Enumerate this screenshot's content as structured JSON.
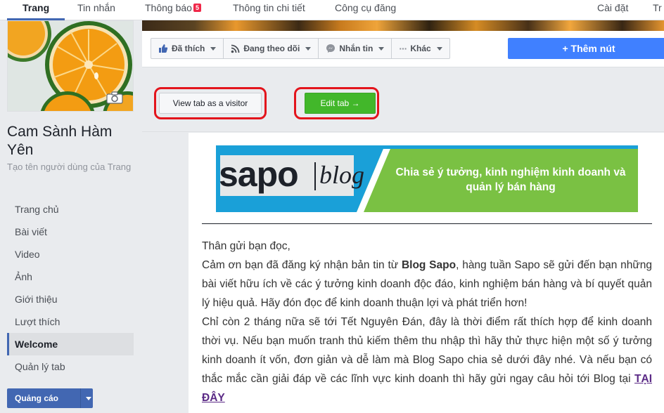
{
  "topnav": {
    "items": [
      "Trang",
      "Tin nhắn",
      "Thông báo",
      "Thông tin chi tiết",
      "Công cụ đăng",
      "Cài đặt",
      "Tr"
    ],
    "notification_count": "5"
  },
  "page": {
    "name": "Cam Sành Hàm Yên",
    "username_hint": "Tạo tên người dùng của Trang"
  },
  "sidebar": {
    "items": [
      {
        "label": "Trang chủ"
      },
      {
        "label": "Bài viết"
      },
      {
        "label": "Video"
      },
      {
        "label": "Ảnh"
      },
      {
        "label": "Giới thiệu"
      },
      {
        "label": "Lượt thích"
      },
      {
        "label": "Welcome"
      },
      {
        "label": "Quản lý tab"
      }
    ],
    "active_index": 6,
    "ads_label": "Quảng cáo"
  },
  "actions": {
    "liked": "Đã thích",
    "following": "Đang theo dõi",
    "message": "Nhắn tin",
    "more": "Khác",
    "add_button": "+ Thêm nút"
  },
  "tab_controls": {
    "view_as_visitor": "View tab as a visitor",
    "edit_tab": "Edit tab →"
  },
  "banner": {
    "brand": "sapo",
    "blog": "blog",
    "tagline": "Chia sẻ ý tưởng, kinh nghiệm kinh doanh và quản lý bán hàng"
  },
  "article": {
    "greeting": "Thân gửi bạn đọc,",
    "p1_a": "Cảm ơn bạn đã đăng ký nhận bản tin từ ",
    "p1_bold": "Blog Sapo",
    "p1_b": ", hàng tuần Sapo sẽ gửi đến bạn những bài viết hữu ích về các ý tưởng kinh doanh độc đáo, kinh nghiệm bán hàng và bí quyết quản lý hiệu quả. Hãy đón đọc để kinh doanh thuận lợi và phát triển hơn!",
    "p2": "Chỉ còn 2 tháng nữa sẽ tới Tết Nguyên Đán, đây là thời điểm rất thích hợp để kinh doanh thời vụ. Nếu bạn muốn tranh thủ kiếm thêm thu nhập thì hãy thử thực hiện một số ý tưởng kinh doanh ít vốn, đơn giản và dễ làm mà Blog Sapo chia sẻ dưới đây nhé. Và nếu bạn có thắc mắc cần giải đáp về các lĩnh vực kinh doanh thì hãy gửi ngay câu hỏi tới Blog tại ",
    "link": "TẠI ĐÂY"
  },
  "colors": {
    "fb_blue": "#4267b2",
    "add_button_blue": "#4080ff",
    "edit_green": "#42b72a",
    "highlight_red": "#e3141c",
    "sapo_cyan": "#1aa0d8",
    "sapo_green": "#7ac143"
  },
  "icons": [
    "like-icon",
    "rss-icon",
    "messenger-icon",
    "more-dots-icon",
    "camera-icon",
    "plus-icon"
  ]
}
